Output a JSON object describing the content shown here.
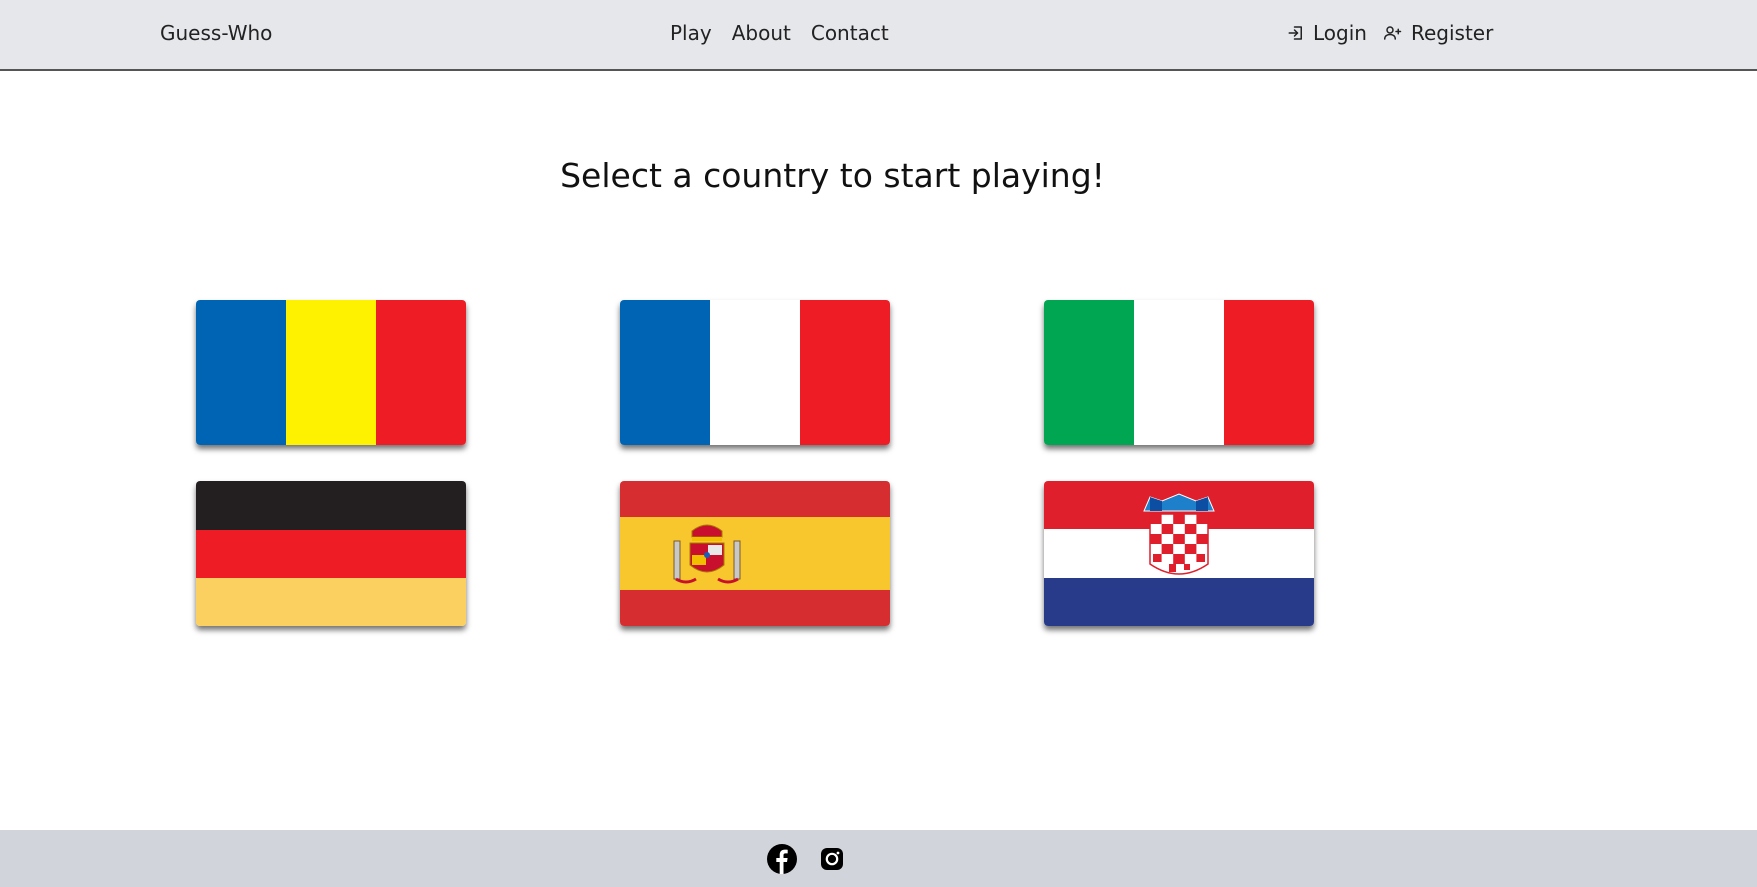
{
  "navbar": {
    "brand": "Guess-Who",
    "links": [
      "Play",
      "About",
      "Contact"
    ],
    "login_label": "Login",
    "register_label": "Register",
    "login_icon": "login-icon",
    "register_icon": "user-plus-icon"
  },
  "main": {
    "title": "Select a country to start playing!",
    "flags": [
      {
        "country": "Romania",
        "colors": [
          "#0064b4",
          "#fff200",
          "#ee1c25"
        ]
      },
      {
        "country": "France",
        "colors": [
          "#0064b4",
          "#ffffff",
          "#ee1c25"
        ]
      },
      {
        "country": "Italy",
        "colors": [
          "#00a651",
          "#ffffff",
          "#ee1c25"
        ]
      },
      {
        "country": "Germany",
        "colors": [
          "#231f20",
          "#ee1c25",
          "#fcd060"
        ]
      },
      {
        "country": "Spain",
        "colors": [
          "#d62d31",
          "#f8c72d",
          "#d62d31"
        ]
      },
      {
        "country": "Croatia",
        "colors": [
          "#df1f2b",
          "#ffffff",
          "#283b8a"
        ]
      }
    ]
  },
  "footer": {
    "icons": [
      "facebook-icon",
      "instagram-icon"
    ],
    "background": "#d1d5db"
  }
}
